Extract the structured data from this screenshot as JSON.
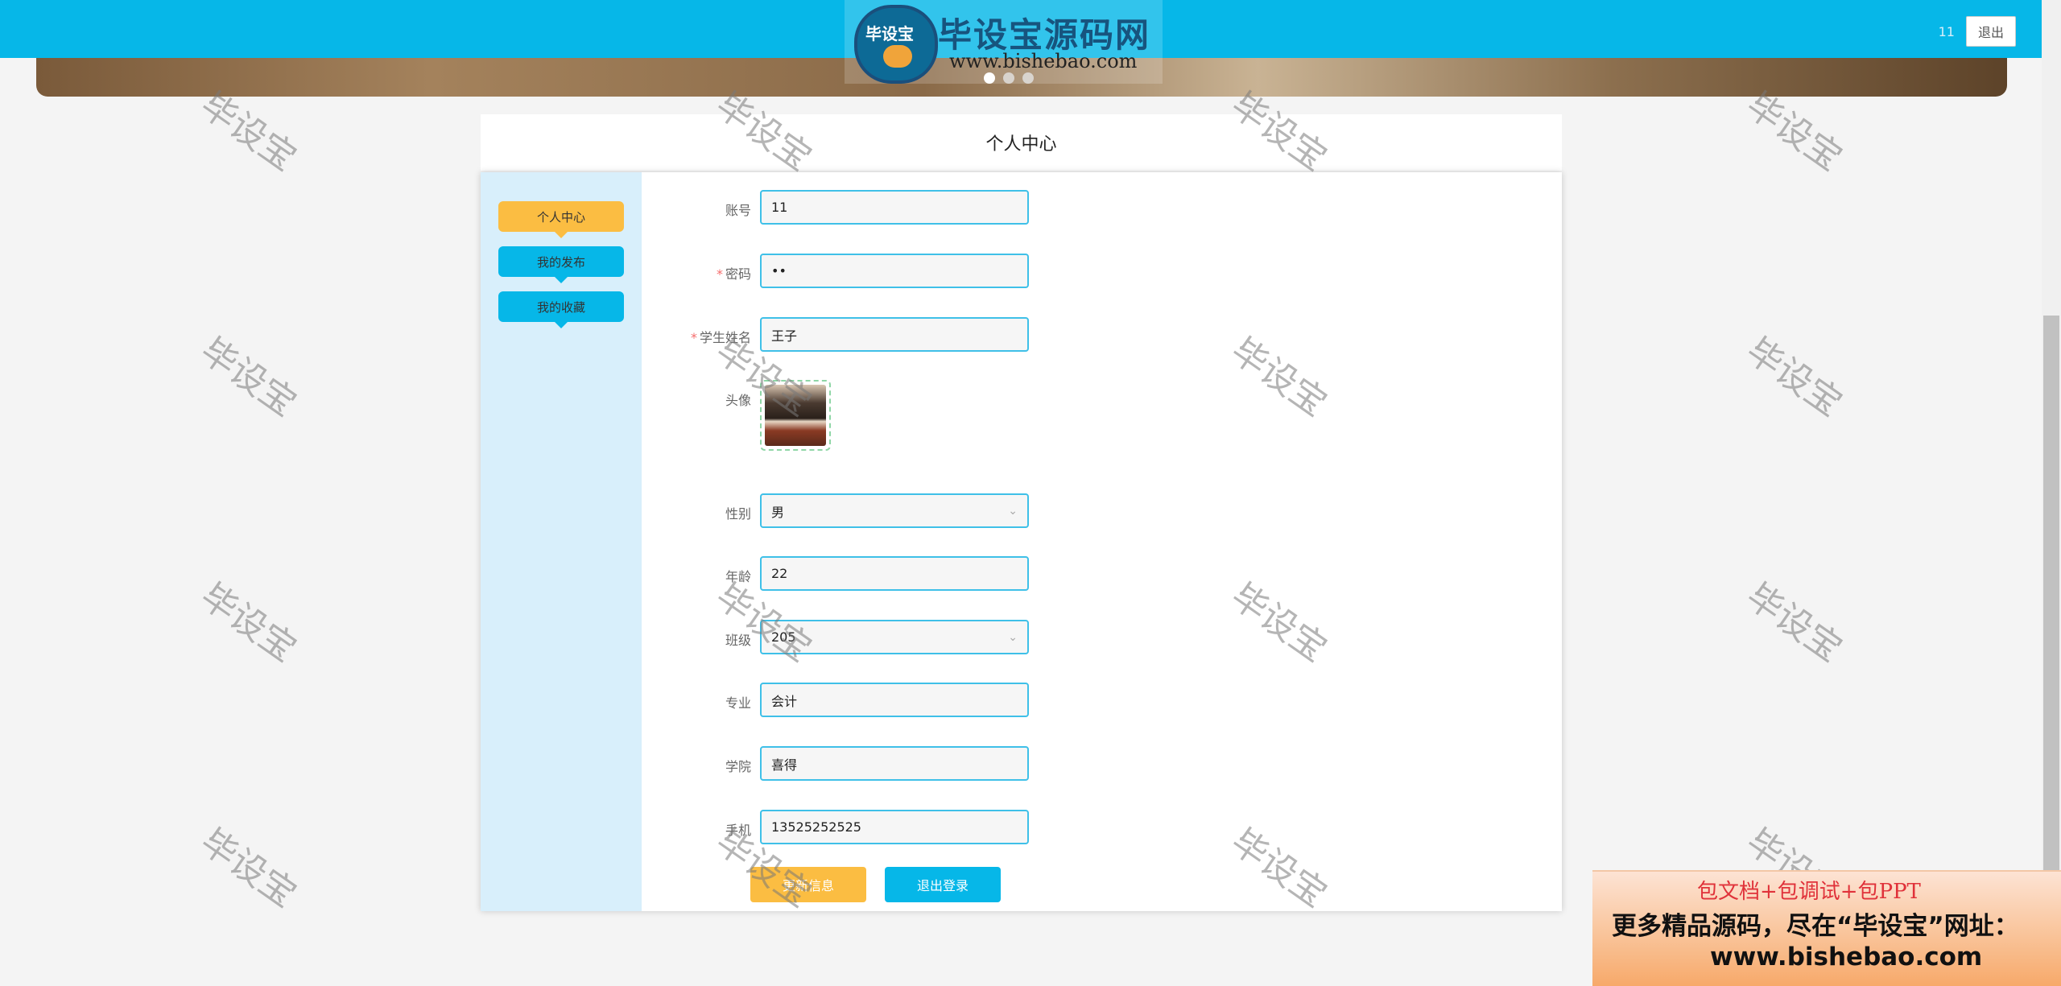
{
  "header": {
    "logo_mascot_text": "毕设宝",
    "logo_title": "毕设宝源码网",
    "logo_url": "www.bishebao.com",
    "username": "11",
    "logout_label": "退出"
  },
  "page_title": "个人中心",
  "sidebar": {
    "items": [
      {
        "label": "个人中心",
        "active": true
      },
      {
        "label": "我的发布",
        "active": false
      },
      {
        "label": "我的收藏",
        "active": false
      }
    ]
  },
  "form": {
    "account": {
      "label": "账号",
      "value": "11"
    },
    "password": {
      "label": "密码",
      "value": "••",
      "required": true
    },
    "student_name": {
      "label": "学生姓名",
      "value": "王子",
      "required": true
    },
    "avatar": {
      "label": "头像"
    },
    "gender": {
      "label": "性别",
      "value": "男"
    },
    "age": {
      "label": "年龄",
      "value": "22"
    },
    "class": {
      "label": "班级",
      "value": "205"
    },
    "major": {
      "label": "专业",
      "value": "会计"
    },
    "college": {
      "label": "学院",
      "value": "喜得"
    },
    "phone": {
      "label": "手机",
      "value": "13525252525"
    },
    "required_mark": "*",
    "update_button": "更新信息",
    "logout_button": "退出登录"
  },
  "watermark_text": "毕设宝",
  "ad": {
    "line1": "包文档+包调试+包PPT",
    "line2": "更多精品源码，尽在“毕设宝”网址：",
    "line3": "www.bishebao.com"
  },
  "colors": {
    "primary": "#06b7e8",
    "accent": "#fbbd42",
    "sidebar_bg": "#d8effb",
    "required": "#f56c6c"
  }
}
